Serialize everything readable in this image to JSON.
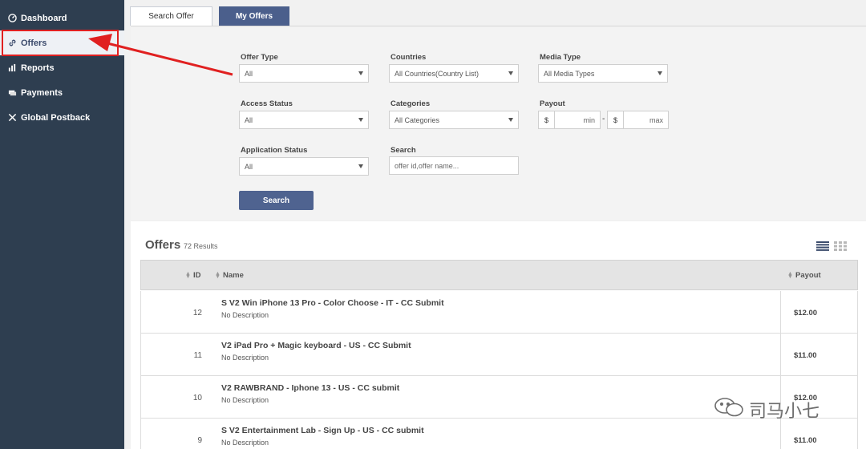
{
  "sidebar": {
    "items": [
      {
        "label": "Dashboard",
        "icon": "dashboard-icon"
      },
      {
        "label": "Offers",
        "icon": "link-icon",
        "active": true
      },
      {
        "label": "Reports",
        "icon": "bar-chart-icon"
      },
      {
        "label": "Payments",
        "icon": "money-icon"
      },
      {
        "label": "Global Postback",
        "icon": "tools-icon"
      }
    ]
  },
  "tabs": {
    "search_offer": "Search Offer",
    "my_offers": "My Offers"
  },
  "filters": {
    "offer_type": {
      "label": "Offer Type",
      "value": "All"
    },
    "countries": {
      "label": "Countries",
      "value": "All Countries(Country List)"
    },
    "media_type": {
      "label": "Media Type",
      "value": "All Media Types"
    },
    "access_status": {
      "label": "Access Status",
      "value": "All"
    },
    "categories": {
      "label": "Categories",
      "value": "All Categories"
    },
    "payout": {
      "label": "Payout",
      "currency": "$",
      "min_placeholder": "min",
      "max_placeholder": "max",
      "separator": "-"
    },
    "application_status": {
      "label": "Application Status",
      "value": "All"
    },
    "search": {
      "label": "Search",
      "placeholder": "offer id,offer name..."
    },
    "search_button": "Search"
  },
  "offers": {
    "title": "Offers",
    "count": "72 Results",
    "columns": {
      "id": "ID",
      "name": "Name",
      "payout": "Payout"
    },
    "rows": [
      {
        "id": "12",
        "name": "S V2 Win iPhone 13 Pro - Color Choose - IT - CC Submit",
        "desc": "No Description",
        "payout": "$12.00"
      },
      {
        "id": "11",
        "name": "V2 iPad Pro + Magic keyboard - US - CC Submit",
        "desc": "No Description",
        "payout": "$11.00"
      },
      {
        "id": "10",
        "name": "V2 RAWBRAND - Iphone 13 - US - CC submit",
        "desc": "No Description",
        "payout": "$12.00"
      },
      {
        "id": "9",
        "name": "S V2 Entertainment Lab - Sign Up - US - CC submit",
        "desc": "No Description",
        "payout": "$11.00"
      }
    ]
  },
  "watermark": "司马小七",
  "colors": {
    "sidebar_bg": "#2e3e50",
    "accent": "#4f6390",
    "highlight": "#e02020"
  }
}
